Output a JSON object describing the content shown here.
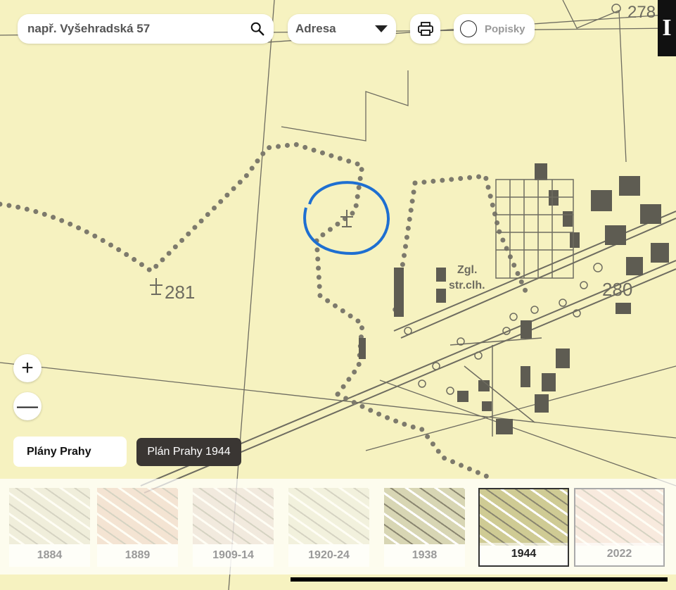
{
  "search": {
    "placeholder": "např. Vyšehradská 57",
    "icon": "search-icon"
  },
  "search_type": {
    "selected": "Adresa"
  },
  "toolbar": {
    "print_icon": "printer-icon",
    "labels_label": "Popisky"
  },
  "info_button": {
    "label": "I"
  },
  "zoom": {
    "in_label": "+",
    "out_label": "—"
  },
  "plans_button": {
    "label": "Plány Prahy"
  },
  "current_plan": {
    "label": "Plán Prahy 1944"
  },
  "map_labels": {
    "elev_281": "281",
    "elev_280": "280",
    "elev_278": "278",
    "brickyard_1": "Zgl.",
    "brickyard_2": "str.clh."
  },
  "map_colors": {
    "paper": "#f6f2c0",
    "ink": "#6e6c60",
    "dots": "#7d7a6c",
    "highlight_circle": "#1e6fd1"
  },
  "timeline": {
    "selected": "1944",
    "items": [
      {
        "year": "1884",
        "tint": "#d8d3b8"
      },
      {
        "year": "1889",
        "tint": "#e2b6a0"
      },
      {
        "year": "1909-14",
        "tint": "#dcc8c0"
      },
      {
        "year": "1920-24",
        "tint": "#dedcbe"
      },
      {
        "year": "1938",
        "tint": "#d8d6b4"
      },
      {
        "year": "1944",
        "tint": "#cfcb94"
      },
      {
        "year": "2022",
        "tint": "#eec8c0"
      }
    ]
  }
}
